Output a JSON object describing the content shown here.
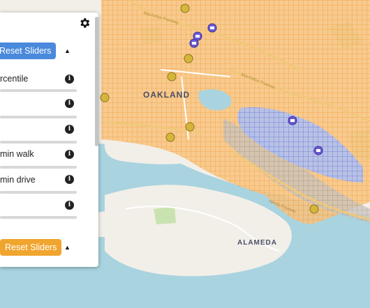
{
  "map": {
    "labels": {
      "oakland": "OAKLAND",
      "alameda": "ALAMEDA"
    },
    "roads": {
      "macarthur_1": "MacArthur Freeway",
      "macarthur_2": "MacArthur Freeway",
      "nimitz": "Nimitz Freeway"
    },
    "colors": {
      "land": "#f2efe9",
      "water": "#a9d3df",
      "park": "#c9e3b0",
      "grid_orange": "#f5a54a",
      "grid_blue": "#7c9cf0",
      "grid_gray": "#a8a8a8",
      "marker_yellow": "#d6b63a",
      "marker_purple": "#6a5ad1"
    }
  },
  "panel": {
    "reset_top": "Reset Sliders",
    "reset_bottom": "Reset Sliders",
    "caret": "▲",
    "rows": [
      {
        "label": "rcentile"
      },
      {
        "label": ""
      },
      {
        "label": ""
      },
      {
        "label": "min walk"
      },
      {
        "label": " min drive"
      },
      {
        "label": ""
      }
    ],
    "icons": {
      "settings": "gear-icon",
      "info": "info-icon",
      "caret": "caret-up-icon"
    }
  }
}
